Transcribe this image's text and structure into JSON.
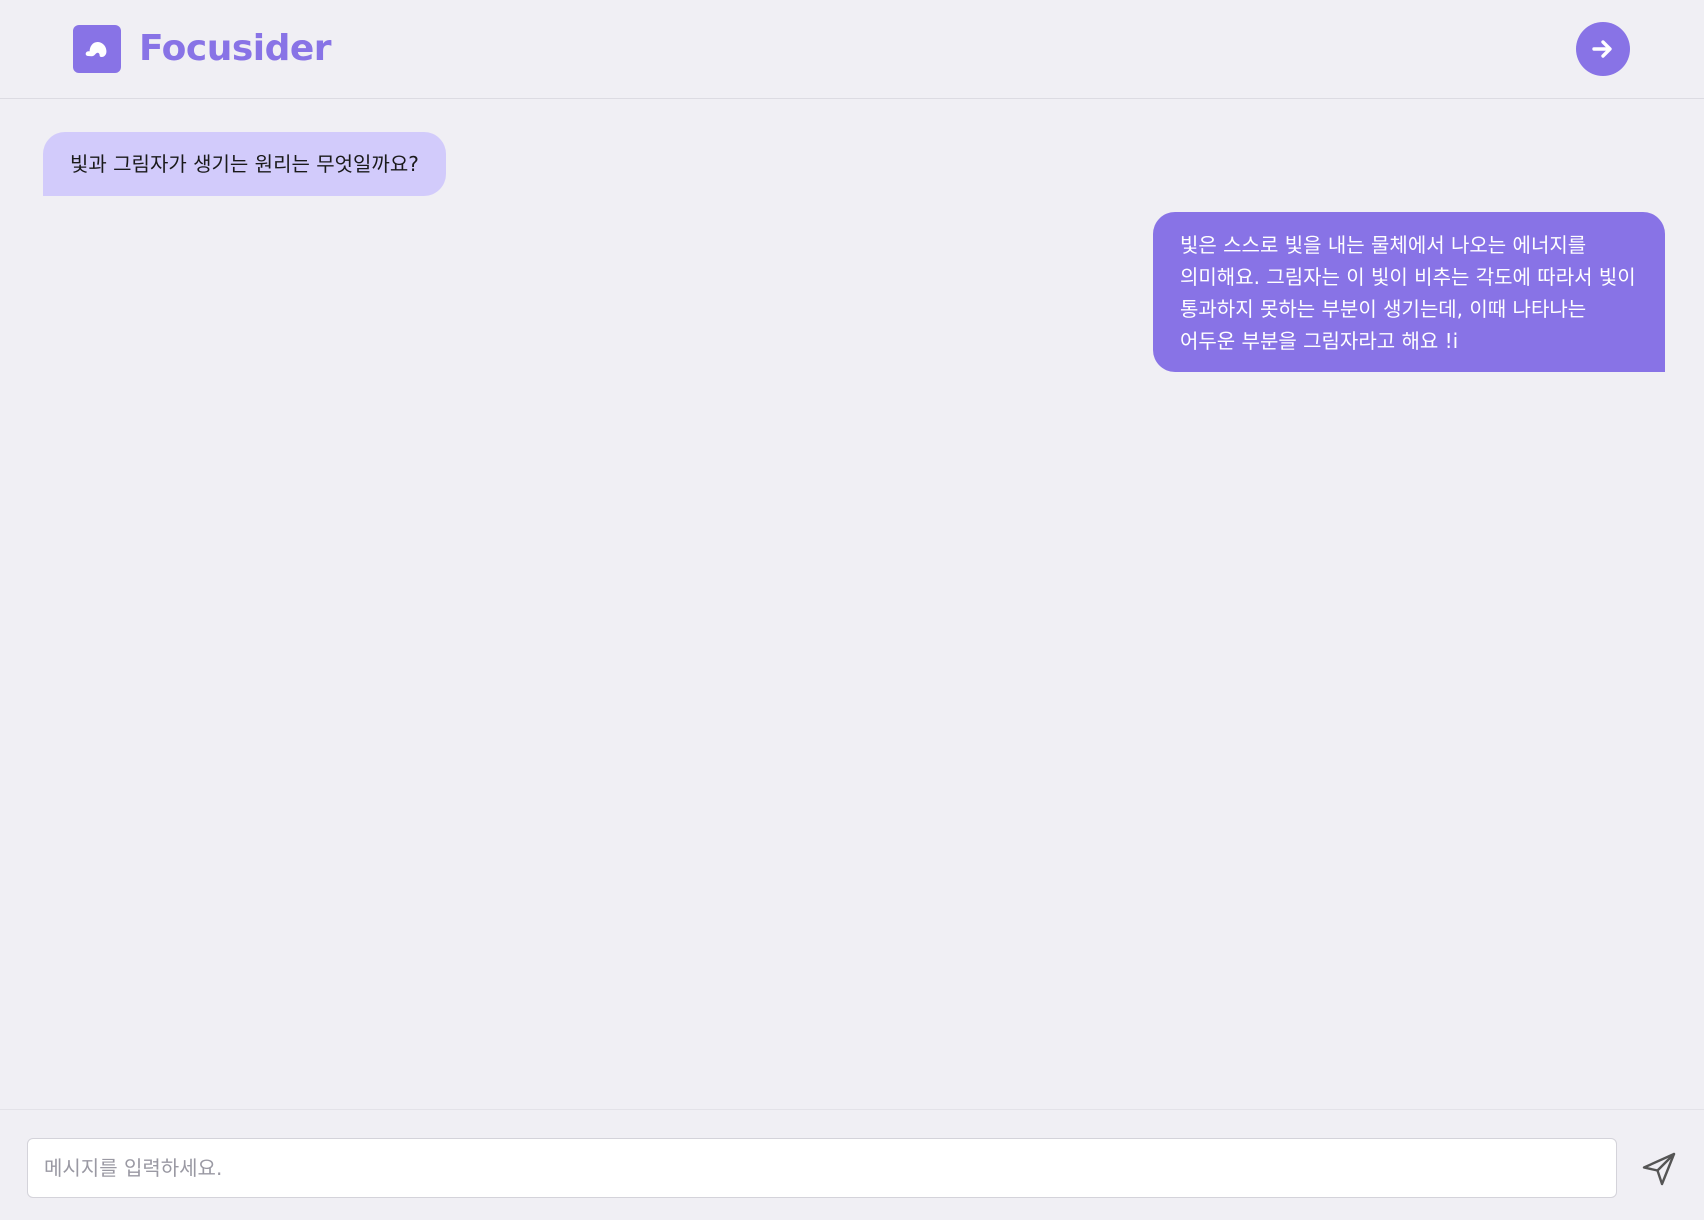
{
  "header": {
    "brand_name": "Focusider",
    "logo_icon": "cloud-logo-icon",
    "exit_icon": "arrow-right-icon"
  },
  "chat": {
    "messages": [
      {
        "role": "user",
        "text": "빛과 그림자가 생기는 원리는 무엇일까요?"
      },
      {
        "role": "assistant",
        "text": "빛은 스스로 빛을 내는 물체에서 나오는 에너지를 의미해요. 그림자는 이 빛이 비추는 각도에 따라서 빛이 통과하지 못하는 부분이 생기는데, 이때 나타나는 어두운 부분을 그림자라고 해요 !i"
      }
    ]
  },
  "composer": {
    "placeholder": "메시지를 입력하세요.",
    "value": "",
    "send_icon": "paper-plane-icon"
  },
  "colors": {
    "accent": "#8873e6",
    "user_bubble": "#d2cbfb",
    "background": "#f0eff4"
  }
}
